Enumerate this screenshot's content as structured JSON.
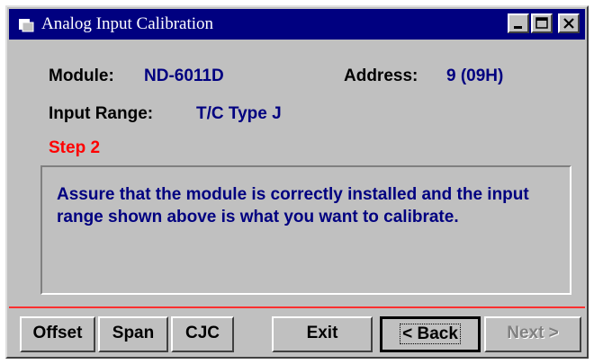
{
  "window": {
    "title": "Analog Input Calibration",
    "controls": {
      "minimize": "minimize-icon",
      "maximize": "maximize-icon",
      "close": "close-icon"
    }
  },
  "info": {
    "module_label": "Module:",
    "module_value": "ND-6011D",
    "address_label": "Address:",
    "address_value": "9 (09H)",
    "range_label": "Input Range:",
    "range_value": "T/C Type J",
    "step": "Step 2"
  },
  "message": "Assure that the module is correctly installed and the input range shown above is what you want to calibrate.",
  "buttons": {
    "offset": "Offset",
    "span": "Span",
    "cjc": "CJC",
    "exit": "Exit",
    "back": "< Back",
    "next": "Next >"
  },
  "colors": {
    "title_bar": "#000080",
    "value_text": "#000080",
    "step_text": "#ff0000",
    "separator": "#ff3030",
    "face": "#c0c0c0"
  }
}
